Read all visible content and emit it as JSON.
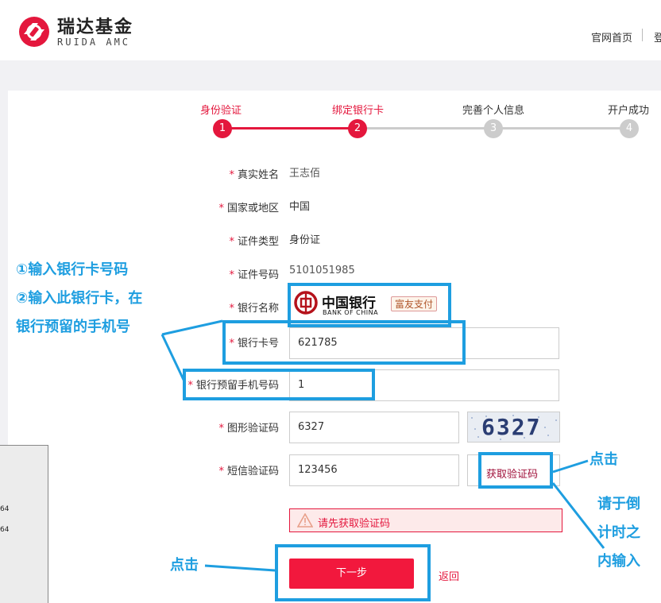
{
  "header": {
    "logo_cn": "瑞达基金",
    "logo_en": "RUIDA AMC",
    "nav_home": "官网首页",
    "nav_login": "登"
  },
  "steps": [
    {
      "label": "身份验证",
      "number": "1",
      "state": "done"
    },
    {
      "label": "绑定银行卡",
      "number": "2",
      "state": "active"
    },
    {
      "label": "完善个人信息",
      "number": "3",
      "state": "todo"
    },
    {
      "label": "开户成功",
      "number": "4",
      "state": "todo"
    }
  ],
  "form": {
    "required_mark": "*",
    "name": {
      "label": "真实姓名",
      "value": "王志佰"
    },
    "region": {
      "label": "国家或地区",
      "value": "中国"
    },
    "id_type": {
      "label": "证件类型",
      "value": "身份证"
    },
    "id_number": {
      "label": "证件号码",
      "value": "5101051985"
    },
    "bank_name": {
      "label": "银行名称",
      "bank_cn": "中国银行",
      "bank_en": "BANK OF CHINA",
      "badge": "富友支付"
    },
    "card_number": {
      "label": "银行卡号",
      "value": "621785"
    },
    "phone": {
      "label": "银行预留手机号码",
      "value": "1"
    },
    "image_code": {
      "label": "图形验证码",
      "value": "6327",
      "captcha": "6327"
    },
    "sms_code": {
      "label": "短信验证码",
      "value": "123456",
      "button": "获取验证码"
    },
    "error": "请先获取验证码",
    "next_button": "下一步",
    "back_link": "返回"
  },
  "annotations": {
    "step_1": "①输入银行卡号码",
    "step_2a": "②输入此银行卡，在",
    "step_2b": "银行预留的手机号",
    "click_sms": "点击",
    "hint_1": "请于倒",
    "hint_2": "计时之",
    "hint_3": "内输入",
    "click_next": "点击",
    "accent_color": "#1e9ee0"
  },
  "side_fragment": {
    "line1": "64",
    "line2": "64"
  }
}
